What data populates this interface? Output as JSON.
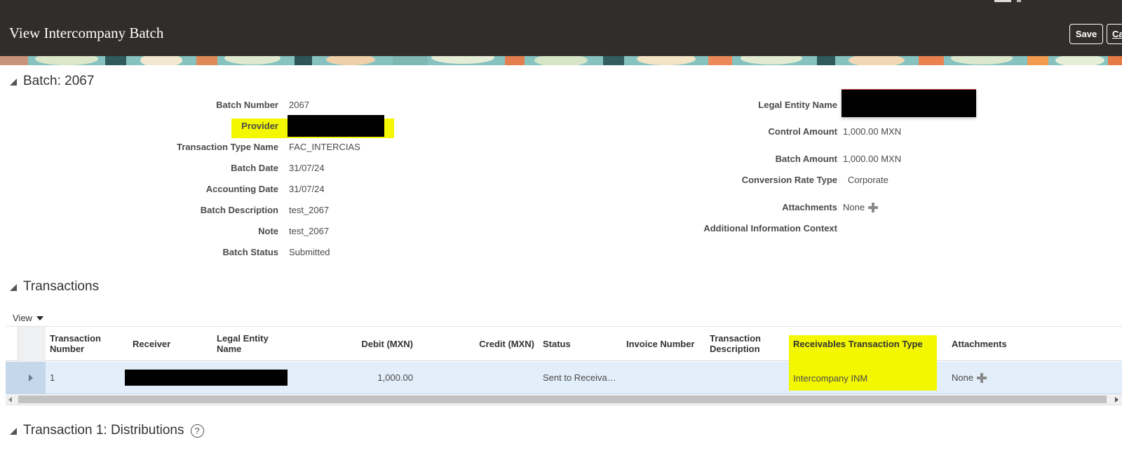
{
  "header": {
    "title": "View Intercompany Batch",
    "save_label": "Save",
    "cancel_label": "Ca"
  },
  "batch": {
    "section_title": "Batch: 2067",
    "fields_left": [
      {
        "label": "Batch Number",
        "value": "2067"
      },
      {
        "label": "Provider",
        "value": ""
      },
      {
        "label": "Transaction Type Name",
        "value": "FAC_INTERCIAS"
      },
      {
        "label": "Batch Date",
        "value": "31/07/24"
      },
      {
        "label": "Accounting Date",
        "value": "31/07/24"
      },
      {
        "label": "Batch Description",
        "value": "test_2067"
      },
      {
        "label": "Note",
        "value": "test_2067"
      },
      {
        "label": "Batch Status",
        "value": "Submitted"
      }
    ],
    "fields_right": [
      {
        "label": "Legal Entity Name",
        "value": ""
      },
      {
        "label": "Control Amount",
        "value": "1,000.00 MXN"
      },
      {
        "label": "Batch Amount",
        "value": "1,000.00 MXN"
      },
      {
        "label": "Conversion Rate Type",
        "value": "Corporate"
      },
      {
        "label": "Attachments",
        "value": "None"
      },
      {
        "label": "Additional Information Context",
        "value": ""
      }
    ]
  },
  "transactions": {
    "section_title": "Transactions",
    "view_label": "View",
    "columns": [
      "Transaction Number",
      "Receiver",
      "Legal Entity Name",
      "Debit (MXN)",
      "Credit (MXN)",
      "Status",
      "Invoice Number",
      "Transaction Description",
      "Receivables Transaction Type",
      "Attachments"
    ],
    "rows": [
      {
        "number": "1",
        "receiver": "",
        "legal_entity": "",
        "debit": "1,000.00",
        "credit": "",
        "status": "Sent to Receiva…",
        "invoice_number": "",
        "description": "",
        "receivables_type": "Intercompany INM",
        "attachments": "None"
      }
    ]
  },
  "distributions": {
    "section_title": "Transaction 1: Distributions",
    "help_glyph": "?"
  },
  "colors": {
    "header_bg": "#312d2a",
    "highlight": "#f3f700",
    "selected_row": "#e2eefa"
  }
}
